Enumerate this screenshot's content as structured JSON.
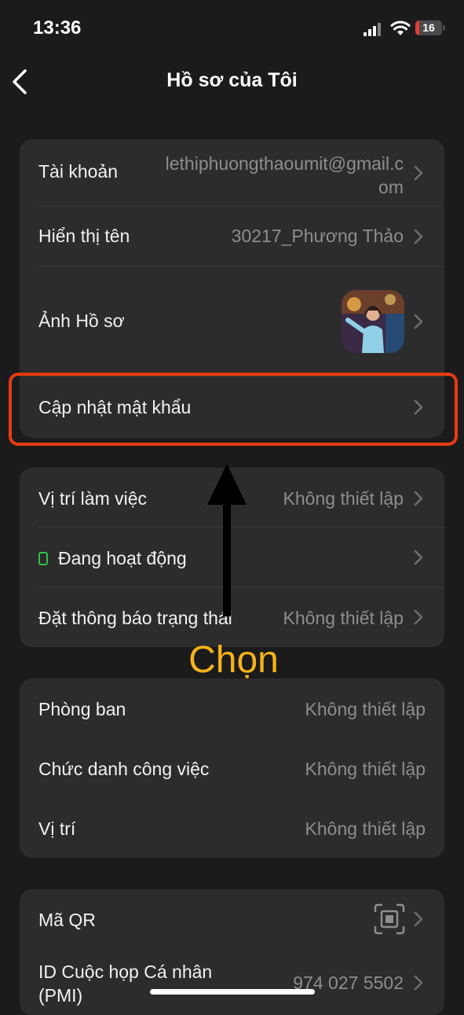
{
  "status_bar": {
    "time": "13:36",
    "battery": "16",
    "battery_level": 0.16
  },
  "header": {
    "title": "Hồ sơ của Tôi"
  },
  "profile_section": {
    "account_label": "Tài khoản",
    "account_value_line1": "lethiphuongthaoumit@gmail.c",
    "account_value_line2": "om",
    "display_name_label": "Hiển thị tên",
    "display_name_value": "30217_Phương Thảo",
    "photo_label": "Ảnh Hồ sơ",
    "update_password_label": "Cập nhật mật khẩu"
  },
  "status_section": {
    "work_location_label": "Vị trí làm việc",
    "work_location_value": "Không thiết lập",
    "active_label": "Đang hoạt động",
    "status_message_label": "Đặt thông báo trạng thái",
    "status_message_value": "Không thiết lập"
  },
  "org_section": {
    "department_label": "Phòng ban",
    "department_value": "Không thiết lập",
    "job_title_label": "Chức danh công việc",
    "job_title_value": "Không thiết lập",
    "location_label": "Vị trí",
    "location_value": "Không thiết lập"
  },
  "extra_section": {
    "qr_label": "Mã QR",
    "pmi_label_line1": "ID Cuộc họp Cá nhân",
    "pmi_label_line2": "(PMI)",
    "pmi_value": "974 027 5502"
  },
  "annotation": {
    "choose_label": "Chọn",
    "highlight_color": "#e63a14",
    "label_color": "#f6b318"
  },
  "colors": {
    "background": "#1b1b1b",
    "card": "#2c2c2c",
    "status_active": "#31c24a"
  }
}
